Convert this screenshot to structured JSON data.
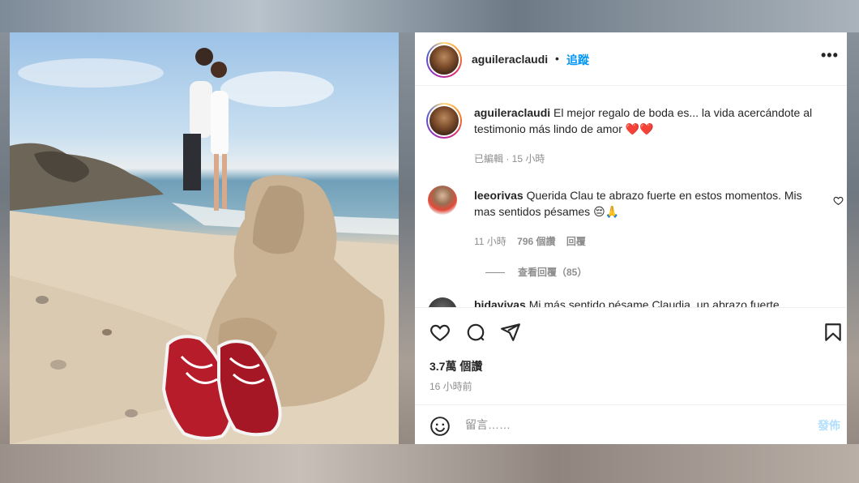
{
  "post": {
    "username": "aguileraclaudi",
    "dot": "•",
    "follow_label": "追蹤",
    "more_label": "•••"
  },
  "caption": {
    "username": "aguileraclaudi",
    "text": "El mejor regalo de boda es... la vida acercándote al testimonio más lindo de amor ❤️❤️",
    "meta": "已編輯 · 15 小時"
  },
  "comments": [
    {
      "username": "leeorivas",
      "text": "Querida Clau te abrazo fuerte en estos momentos. Mis mas sentidos pésames 😔🙏",
      "time": "11 小時",
      "likes": "796 個讚",
      "reply_label": "回覆",
      "view_replies_label": "查看回覆（85）"
    },
    {
      "username": "bidavivas",
      "text": "Mi más sentido pésame Claudia, un abrazo fuerte"
    }
  ],
  "actions": {
    "likes_count": "3.7萬 個讚",
    "time": "16 小時前"
  },
  "add_comment": {
    "placeholder": "留言……",
    "post_label": "發佈"
  },
  "icons": [
    "heart-icon",
    "comment-icon",
    "share-icon",
    "bookmark-icon",
    "emoji-icon",
    "more-icon"
  ],
  "colors": {
    "link": "#0095f6",
    "text": "#262626",
    "muted": "#8e8e8e"
  }
}
